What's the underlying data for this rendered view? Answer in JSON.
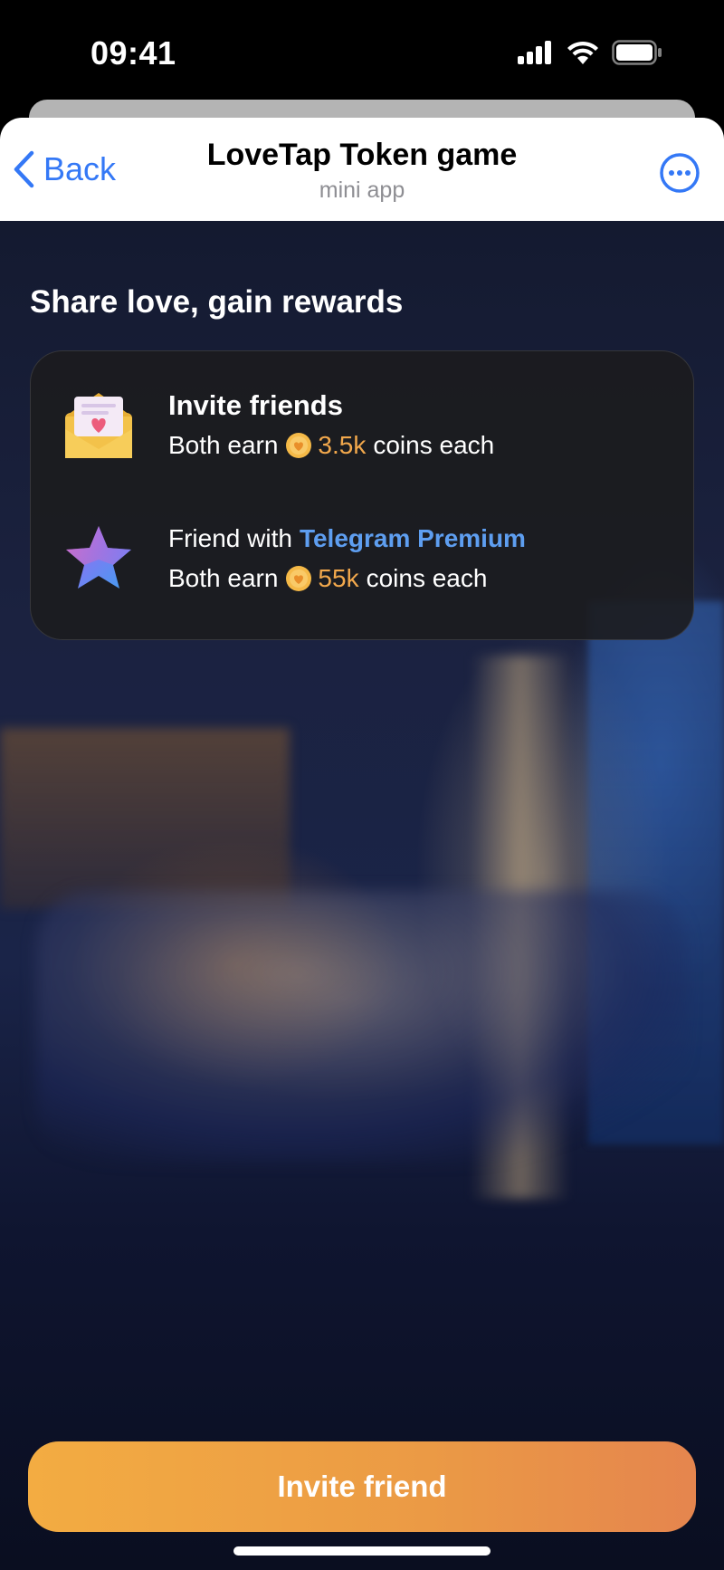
{
  "status_bar": {
    "time": "09:41",
    "icons": [
      "cellular-signal-icon",
      "wifi-icon",
      "battery-icon"
    ]
  },
  "header": {
    "back_label": "Back",
    "title": "LoveTap Token game",
    "subtitle": "mini app",
    "more_icon": "ellipsis-circle-icon"
  },
  "main": {
    "section_title": "Share love, gain rewards",
    "rewards": [
      {
        "icon": "envelope-heart-icon",
        "title": "Invite friends",
        "prefix": "Both earn",
        "amount": "3.5k",
        "suffix": "coins each"
      },
      {
        "icon": "premium-star-icon",
        "title_prefix": "Friend with",
        "title_highlight": "Telegram Premium",
        "prefix": "Both earn",
        "amount": "55k",
        "suffix": "coins each"
      }
    ]
  },
  "footer": {
    "invite_button_label": "Invite friend"
  },
  "colors": {
    "accent_blue": "#3478f6",
    "coin_orange": "#f2a84c",
    "premium_blue": "#5e9ef0",
    "button_gradient_start": "#f3ac42",
    "button_gradient_end": "#e5854e"
  }
}
